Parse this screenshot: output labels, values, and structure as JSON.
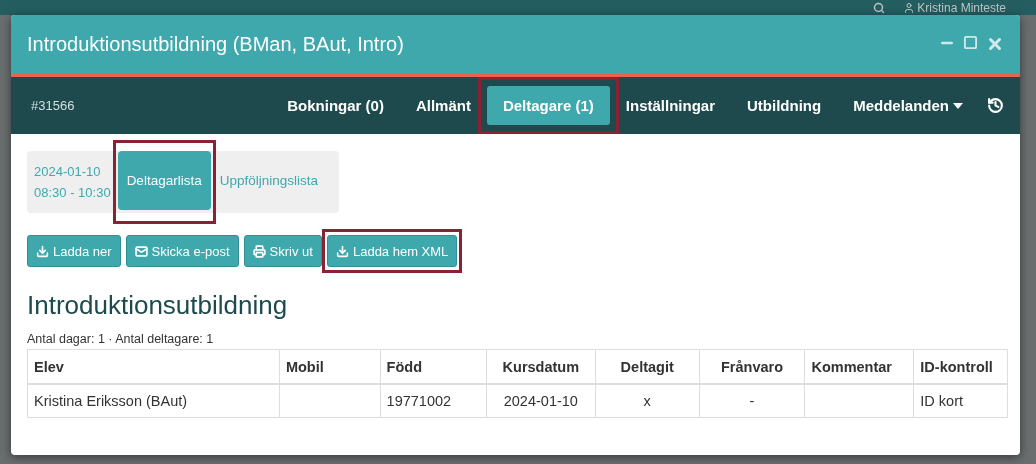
{
  "background": {
    "user_name": "Kristina Minteste"
  },
  "window": {
    "title": "Introduktionsutbildning (BMan, BAut, Intro)"
  },
  "nav": {
    "id": "#31566",
    "tabs": [
      {
        "label": "Bokningar (0)",
        "selected": false,
        "highlighted": false,
        "dropdown": false
      },
      {
        "label": "Allmänt",
        "selected": false,
        "highlighted": false,
        "dropdown": false
      },
      {
        "label": "Deltagare (1)",
        "selected": true,
        "highlighted": true,
        "dropdown": false
      },
      {
        "label": "Inställningar",
        "selected": false,
        "highlighted": false,
        "dropdown": false
      },
      {
        "label": "Utbildning",
        "selected": false,
        "highlighted": false,
        "dropdown": false
      },
      {
        "label": "Meddelanden",
        "selected": false,
        "highlighted": false,
        "dropdown": true
      }
    ]
  },
  "session": {
    "date": "2024-01-10",
    "time": "08:30 - 10:30"
  },
  "subtabs": [
    {
      "label": "Deltagarlista",
      "selected": true,
      "highlighted": true
    },
    {
      "label": "Uppföljningslista",
      "selected": false,
      "highlighted": false
    }
  ],
  "buttons": [
    {
      "label": "Ladda ner",
      "highlighted": false
    },
    {
      "label": "Skicka e-post",
      "highlighted": false
    },
    {
      "label": "Skriv ut",
      "highlighted": false
    },
    {
      "label": "Ladda hem XML",
      "highlighted": true
    }
  ],
  "heading": "Introduktionsutbildning",
  "summary": "Antal dagar: 1 · Antal deltagare: 1",
  "table": {
    "columns": [
      "Elev",
      "Mobil",
      "Född",
      "Kursdatum",
      "Deltagit",
      "Frånvaro",
      "Kommentar",
      "ID-kontroll"
    ],
    "rows": [
      {
        "cells": [
          "Kristina Eriksson (BAut)",
          null,
          "19771002",
          "2024-01-10",
          "x",
          "-",
          null,
          "ID kort"
        ]
      }
    ]
  }
}
